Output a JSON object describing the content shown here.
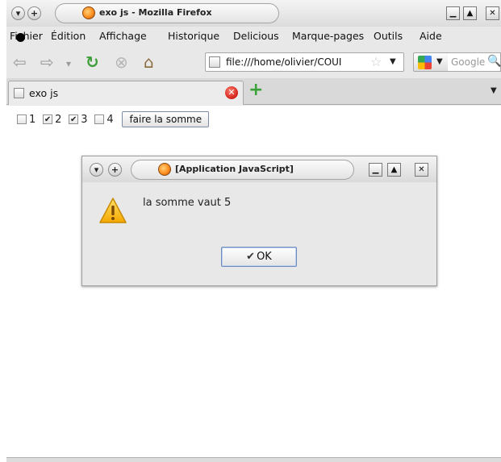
{
  "window": {
    "title": "exo js - Mozilla Firefox"
  },
  "menu": {
    "items": [
      "Fichier",
      "Édition",
      "Affichage",
      "Historique",
      "Delicious",
      "Marque-pages",
      "Outils",
      "Aide"
    ]
  },
  "navbar": {
    "url": "file:///home/olivier/COUI",
    "search_placeholder": "Google"
  },
  "tabs": [
    {
      "label": "exo js"
    }
  ],
  "page": {
    "checkboxes": [
      {
        "label": "1",
        "checked": false
      },
      {
        "label": "2",
        "checked": true
      },
      {
        "label": "3",
        "checked": true
      },
      {
        "label": "4",
        "checked": false
      }
    ],
    "sum_button": "faire la somme"
  },
  "dialog": {
    "title": "[Application JavaScript]",
    "message": "la somme vaut 5",
    "ok_label": "OK"
  },
  "colors": {
    "accent": "#6d8bbd",
    "warning": "#f5b800",
    "close_red": "#d2221a",
    "add_green": "#3aa23a"
  }
}
